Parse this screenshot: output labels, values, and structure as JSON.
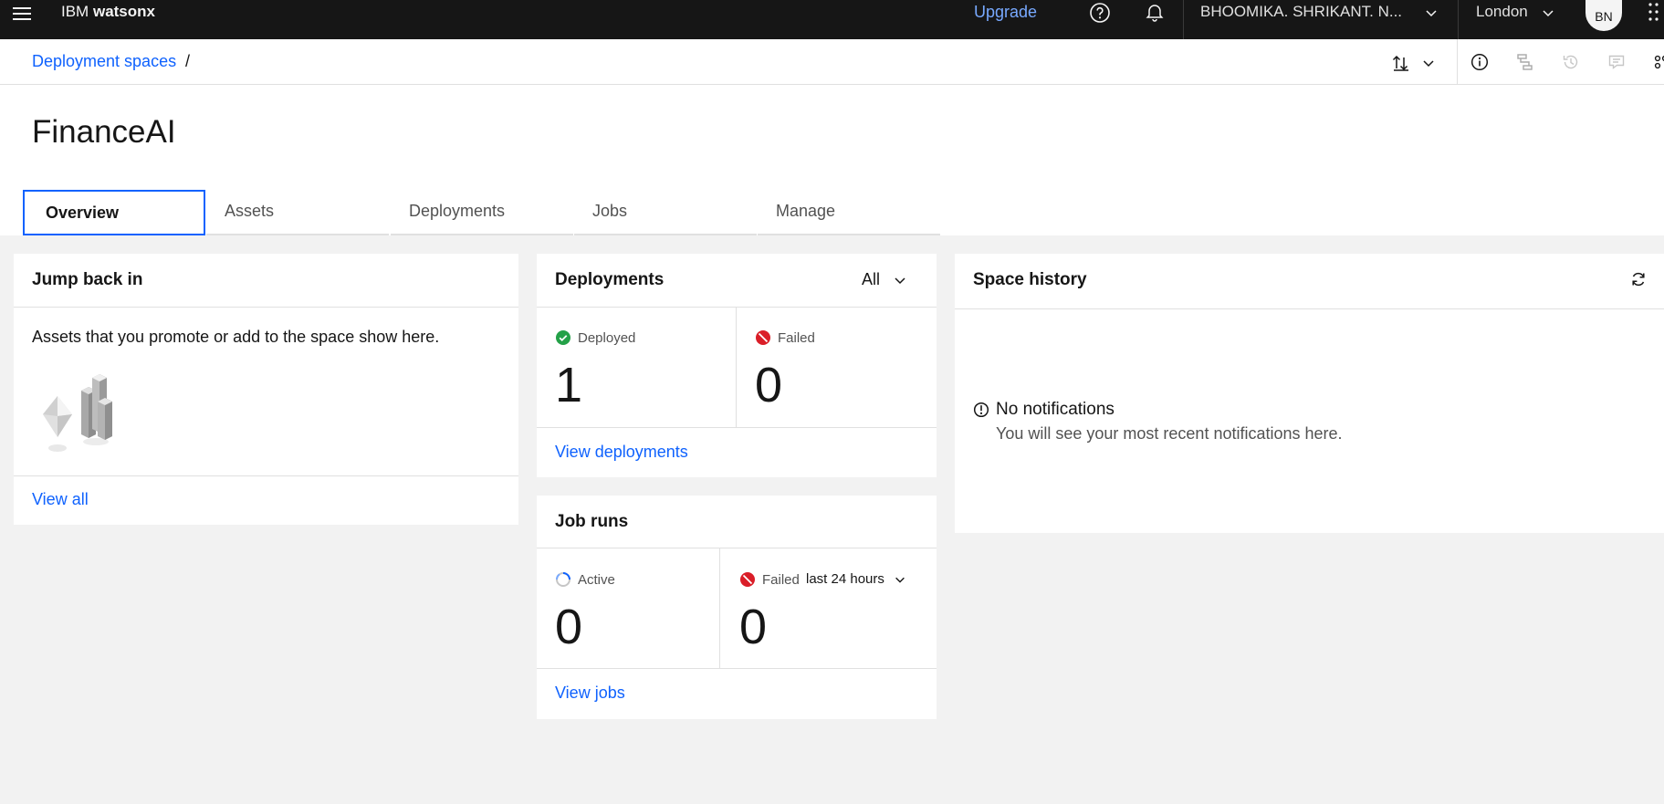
{
  "header": {
    "brand_prefix": "IBM",
    "brand_name": "watsonx",
    "upgrade": "Upgrade",
    "account": "BHOOMIKA. SHRIKANT. N...",
    "region": "London",
    "avatar_initials": "BN"
  },
  "breadcrumb": {
    "link": "Deployment spaces",
    "separator": "/"
  },
  "page": {
    "title": "FinanceAI"
  },
  "tabs": [
    {
      "label": "Overview",
      "active": true
    },
    {
      "label": "Assets",
      "active": false
    },
    {
      "label": "Deployments",
      "active": false
    },
    {
      "label": "Jobs",
      "active": false
    },
    {
      "label": "Manage",
      "active": false
    }
  ],
  "jump_back_in": {
    "title": "Jump back in",
    "description": "Assets that you promote or add to the space show here.",
    "link": "View all"
  },
  "deployments": {
    "title": "Deployments",
    "filter": "All",
    "deployed_label": "Deployed",
    "deployed_count": "1",
    "failed_label": "Failed",
    "failed_count": "0",
    "link": "View deployments"
  },
  "job_runs": {
    "title": "Job runs",
    "active_label": "Active",
    "active_count": "0",
    "failed_label": "Failed",
    "period": "last 24 hours",
    "failed_count": "0",
    "link": "View jobs"
  },
  "space_history": {
    "title": "Space history",
    "empty_title": "No notifications",
    "empty_text": "You will see your most recent notifications here."
  },
  "colors": {
    "header_bg": "#161616",
    "link_blue": "#0f62fe",
    "upgrade_blue": "#78a9ff",
    "success_green": "#24a148",
    "error_red": "#da1e28"
  }
}
